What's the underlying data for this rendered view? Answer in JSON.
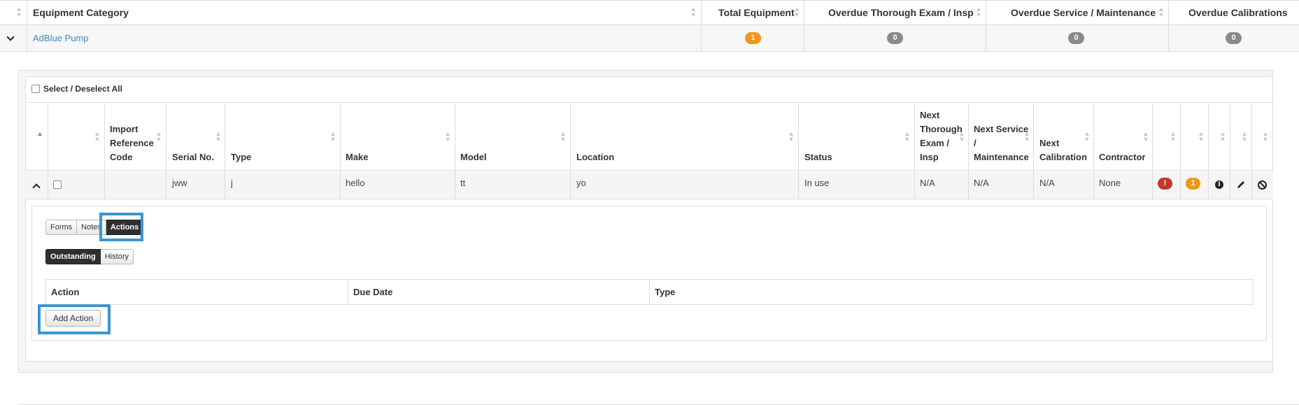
{
  "summary_table": {
    "headers": [
      "Equipment Category",
      "Total Equipment",
      "Overdue Thorough Exam / Insp",
      "Overdue Service / Maintenance",
      "Overdue Calibrations"
    ],
    "row": {
      "category": "AdBlue Pump",
      "total_equipment": "1",
      "overdue_thorough": "0",
      "overdue_service": "0",
      "overdue_calibrations": "0"
    }
  },
  "select_all_label": "Select / Deselect All",
  "equipment_table": {
    "headers": {
      "import_ref": [
        "Import",
        "Reference",
        "Code"
      ],
      "serial": "Serial No.",
      "type": "Type",
      "make": "Make",
      "model": "Model",
      "location": "Location",
      "status": "Status",
      "next_thorough": [
        "Next",
        "Thorough",
        "Exam /",
        "Insp"
      ],
      "next_service": [
        "Next Service",
        "/",
        "Maintenance"
      ],
      "next_calibration": [
        "Next",
        "Calibration"
      ],
      "contractor": "Contractor"
    },
    "row": {
      "import_ref": "",
      "serial": "jww",
      "type": "j",
      "make": "hello",
      "model": "tt",
      "location": "yo",
      "status": "In use",
      "next_thorough": "N/A",
      "next_service": "N/A",
      "next_calibration": "N/A",
      "contractor": "None",
      "alert_badge": "!",
      "count_badge": "1"
    }
  },
  "detail": {
    "tabs": [
      "Forms",
      "Notes",
      "Actions"
    ],
    "active_tab": "Actions",
    "subtabs": [
      "Outstanding",
      "History"
    ],
    "active_subtab": "Outstanding",
    "actions_headers": [
      "Action",
      "Due Date",
      "Type"
    ],
    "add_action_label": "Add Action"
  },
  "colors": {
    "link": "#3a8ac8",
    "badge_orange": "#f0961d",
    "badge_grey": "#8a8a8a",
    "badge_red": "#c0392b",
    "highlight_blue": "#3a95d1"
  }
}
